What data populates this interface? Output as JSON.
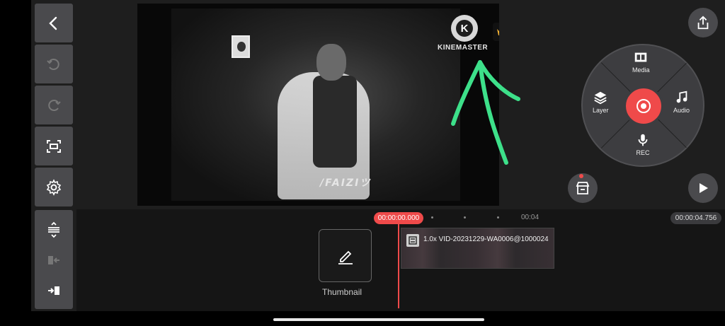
{
  "preview": {
    "overlay_text": "/FAIZIツ",
    "watermark_logo": "K",
    "watermark_text": "KINEMASTER"
  },
  "wheel": {
    "media_label": "Media",
    "layer_label": "Layer",
    "audio_label": "Audio",
    "rec_label": "REC"
  },
  "timeline": {
    "current_time": "00:00:00.000",
    "ruler_mark": "00:04",
    "total_time": "00:00:04.756",
    "thumbnail_label": "Thumbnail",
    "clip_label": "1.0x VID-20231229-WA0006@1000024"
  },
  "colors": {
    "accent": "#ef4a4a",
    "annotation_arrow": "#3de08a",
    "button_bg": "#4a4a4d"
  }
}
